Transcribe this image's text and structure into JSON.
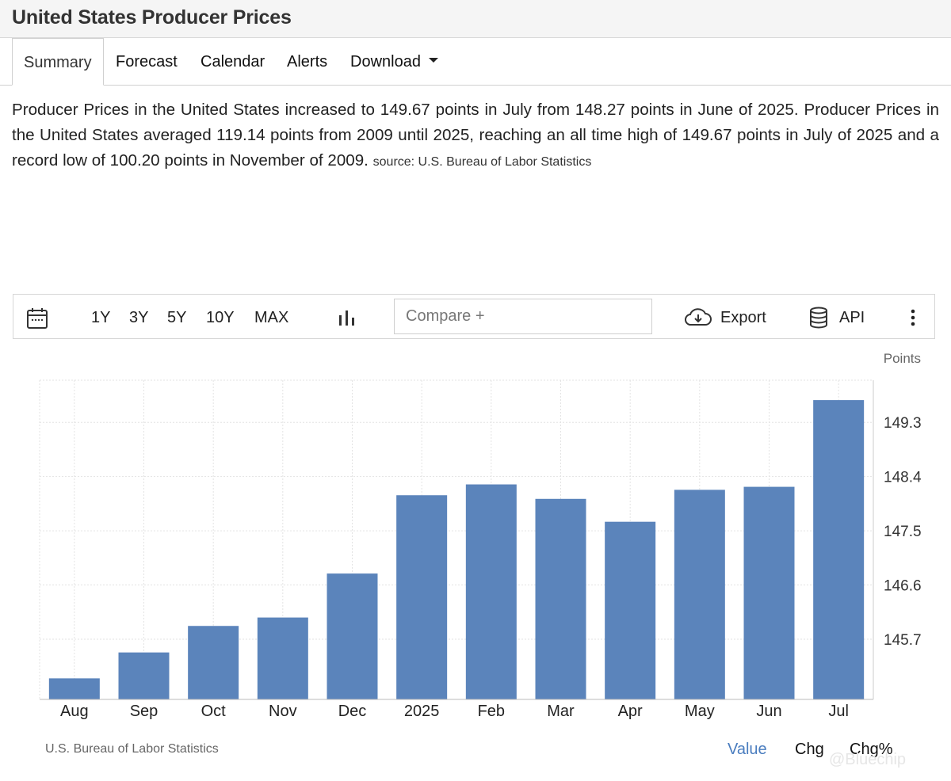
{
  "page": {
    "title": "United States Producer Prices"
  },
  "tabs": [
    {
      "label": "Summary",
      "active": true
    },
    {
      "label": "Forecast"
    },
    {
      "label": "Calendar"
    },
    {
      "label": "Alerts"
    },
    {
      "label": "Download"
    }
  ],
  "summary": {
    "text": "Producer Prices in the United States increased to 149.67 points in July from 148.27 points in June of 2025. Producer Prices in the United States averaged 119.14 points from 2009 until 2025, reaching an all time high of 149.67 points in July of 2025 and a record low of 100.20 points in November of 2009.",
    "source": "source: U.S. Bureau of Labor Statistics"
  },
  "toolbar": {
    "ranges": [
      "1Y",
      "3Y",
      "5Y",
      "10Y",
      "MAX"
    ],
    "compare_placeholder": "Compare +",
    "export_label": "Export",
    "api_label": "API",
    "icons": [
      "calendar-icon",
      "bar-chart-icon",
      "cloud-download-icon",
      "database-icon",
      "more-vertical-icon"
    ]
  },
  "chart_data": {
    "type": "bar",
    "categories": [
      "Aug",
      "Sep",
      "Oct",
      "Nov",
      "Dec",
      "2025",
      "Feb",
      "Mar",
      "Apr",
      "May",
      "Jun",
      "Jul"
    ],
    "values": [
      145.05,
      145.48,
      145.92,
      146.06,
      146.79,
      148.09,
      148.27,
      148.03,
      147.65,
      148.18,
      148.23,
      149.67
    ],
    "ylabel": "Points",
    "y_ticks": [
      145.7,
      146.6,
      147.5,
      148.4,
      149.3
    ],
    "ylim": [
      144.7,
      150.0
    ],
    "grid": true,
    "bar_color": "#5b84bb",
    "source": "U.S. Bureau of Labor Statistics"
  },
  "view_tabs": [
    {
      "label": "Value",
      "active": true
    },
    {
      "label": "Chg"
    },
    {
      "label": "Chg%"
    }
  ],
  "watermark": "@Bluechip",
  "colors": {
    "accent": "#4a7dbf",
    "header_bg": "#f5f5f5"
  }
}
